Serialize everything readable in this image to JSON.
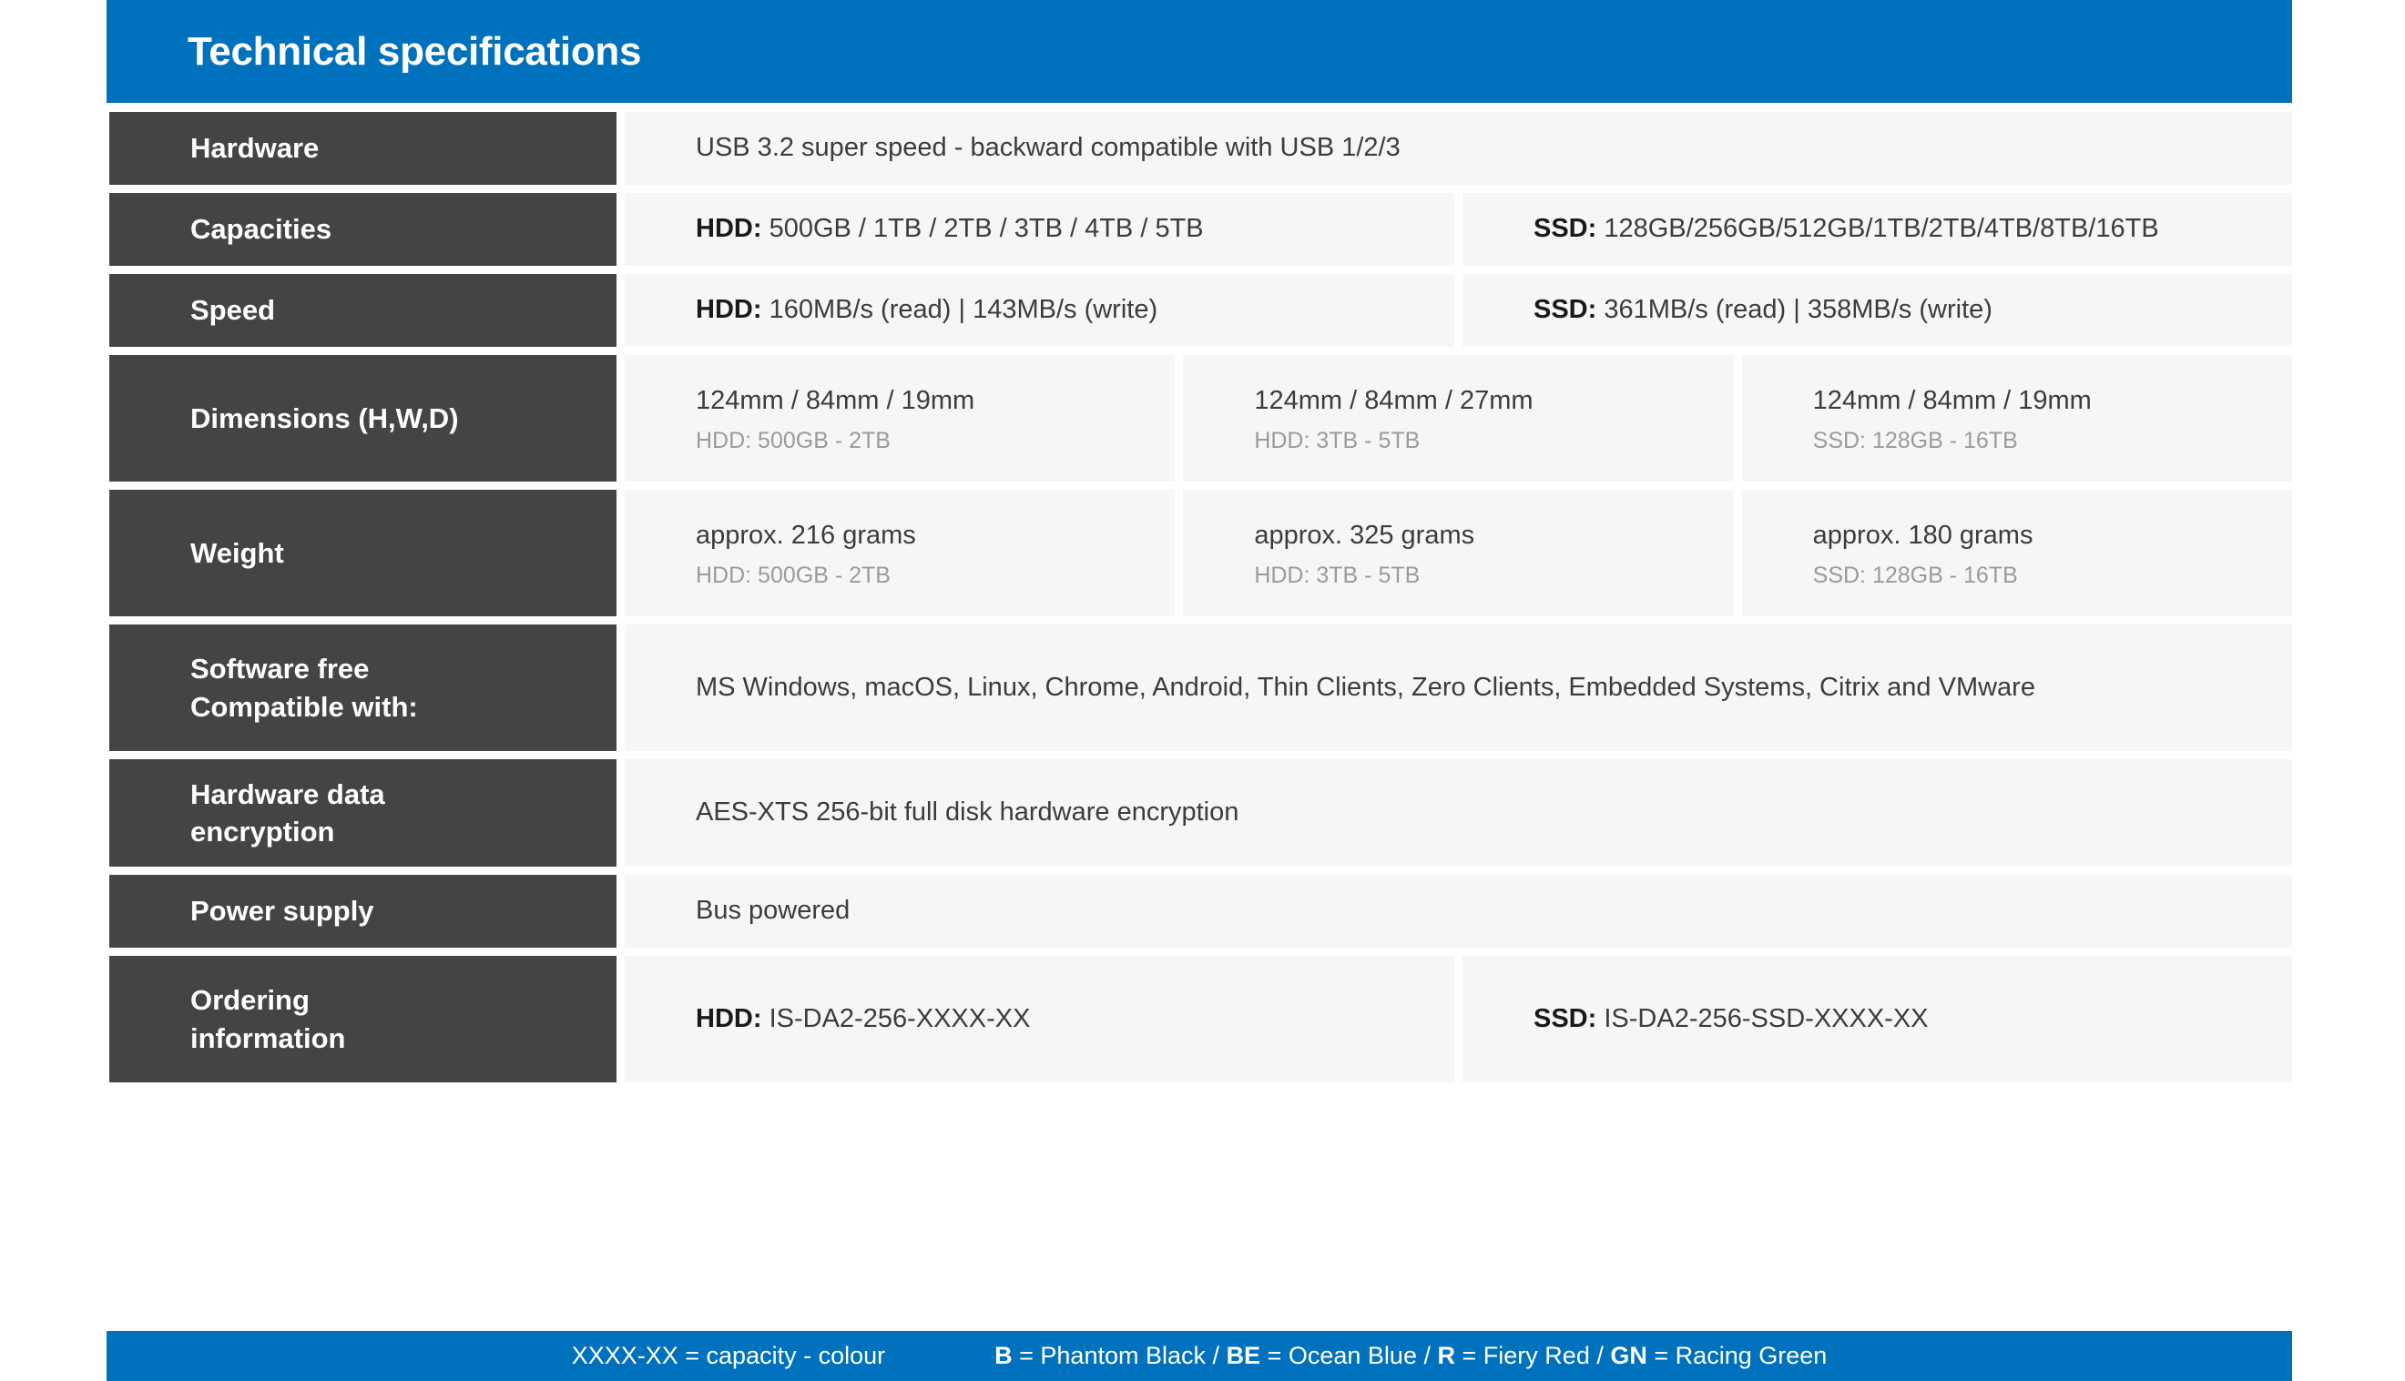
{
  "header": {
    "title": "Technical specifications",
    "bar_color": "#0071BC"
  },
  "theme": {
    "label_cell_color": "#444444",
    "value_cell_color": "#F6F6F6",
    "accent_color": "#0071BC",
    "sub_label_color": "#9B9B9B"
  },
  "rows": {
    "hardware": {
      "label": "Hardware",
      "value": "USB 3.2 super speed - backward compatible with USB 1/2/3"
    },
    "capacities": {
      "label": "Capacities",
      "hdd_prefix": "HDD:",
      "hdd_value": "500GB / 1TB / 2TB / 3TB / 4TB / 5TB",
      "ssd_prefix": "SSD:",
      "ssd_value": "128GB/256GB/512GB/1TB/2TB/4TB/8TB/16TB"
    },
    "speed": {
      "label": "Speed",
      "hdd_prefix": "HDD:",
      "hdd_value": "160MB/s (read) | 143MB/s (write)",
      "ssd_prefix": "SSD:",
      "ssd_value": "361MB/s (read) | 358MB/s (write)"
    },
    "dimensions": {
      "label": "Dimensions (H,W,D)",
      "col1_value": "124mm / 84mm / 19mm",
      "col1_sub": "HDD: 500GB - 2TB",
      "col2_value": "124mm / 84mm / 27mm",
      "col2_sub": "HDD: 3TB - 5TB",
      "col3_value": "124mm / 84mm / 19mm",
      "col3_sub": "SSD: 128GB - 16TB"
    },
    "weight": {
      "label": "Weight",
      "col1_value": "approx. 216 grams",
      "col1_sub": "HDD: 500GB - 2TB",
      "col2_value": "approx. 325 grams",
      "col2_sub": "HDD: 3TB - 5TB",
      "col3_value": "approx. 180 grams",
      "col3_sub": "SSD: 128GB - 16TB"
    },
    "software": {
      "label_line1": "Software free",
      "label_line2": "Compatible with:",
      "value": "MS Windows, macOS, Linux, Chrome, Android, Thin Clients, Zero Clients, Embedded Systems, Citrix and VMware"
    },
    "encryption": {
      "label_line1": "Hardware data",
      "label_line2": "encryption",
      "value": "AES-XTS 256-bit full disk hardware encryption"
    },
    "power": {
      "label": "Power supply",
      "value": "Bus powered"
    },
    "ordering": {
      "label_line1": "Ordering",
      "label_line2": "information",
      "hdd_prefix": "HDD:",
      "hdd_value": "IS-DA2-256-XXXX-XX",
      "ssd_prefix": "SSD:",
      "ssd_value": "IS-DA2-256-SSD-XXXX-XX"
    }
  },
  "footer": {
    "capacity_note": "XXXX-XX = capacity - colour",
    "colour_codes": [
      {
        "code": "B",
        "name": "= Phantom Black"
      },
      {
        "code": "BE",
        "name": "= Ocean Blue"
      },
      {
        "code": "R",
        "name": "= Fiery Red"
      },
      {
        "code": "GN",
        "name": "= Racing Green"
      }
    ],
    "separator": "/"
  }
}
